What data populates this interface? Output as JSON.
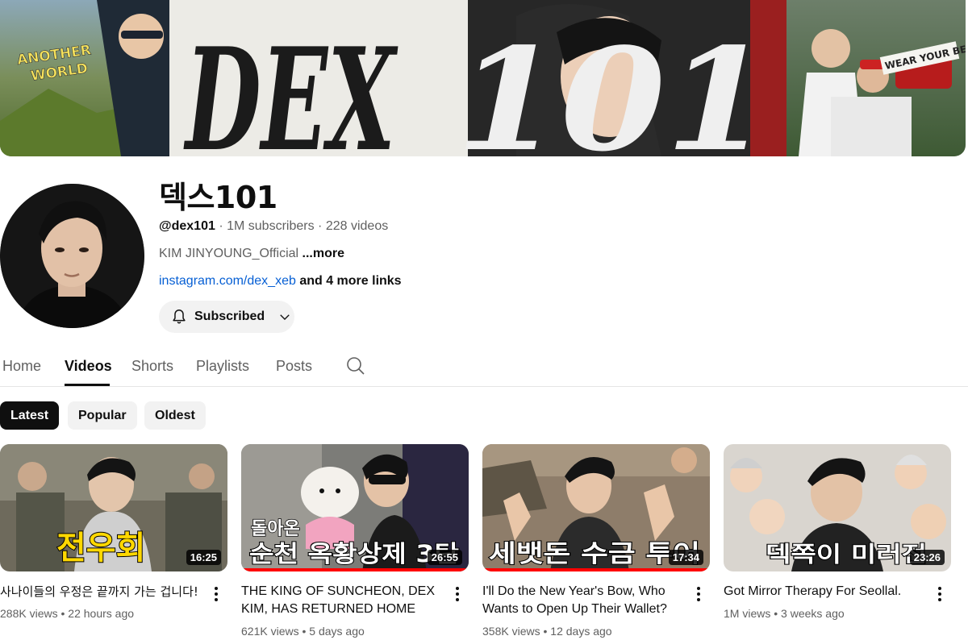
{
  "channel": {
    "name": "덱스101",
    "handle": "@dex101",
    "subscribers": "1M subscribers",
    "videos_count": "228 videos",
    "separator": "·",
    "description": "KIM JINYOUNG_Official",
    "description_more": "...more",
    "link_text": "instagram.com/dex_xeb",
    "more_links": "and 4 more links",
    "subscribe_label": "Subscribed"
  },
  "banner": {
    "title_text": "DEX101",
    "badge_left": "ANOTHER WORLD",
    "badge_right": "WEAR YOUR BEST"
  },
  "tabs": [
    {
      "label": "Home",
      "active": false
    },
    {
      "label": "Videos",
      "active": true
    },
    {
      "label": "Shorts",
      "active": false
    },
    {
      "label": "Playlists",
      "active": false
    },
    {
      "label": "Posts",
      "active": false
    }
  ],
  "chips": [
    {
      "label": "Latest",
      "active": true
    },
    {
      "label": "Popular",
      "active": false
    },
    {
      "label": "Oldest",
      "active": false
    }
  ],
  "videos": [
    {
      "title": "사나이들의 우정은 끝까지 가는 겁니다!",
      "duration": "16:25",
      "views": "288K views",
      "age": "22 hours ago",
      "thumb_caption": "전우회",
      "progress": 0.0
    },
    {
      "title": "THE KING OF SUNCHEON, DEX KIM, HAS RETURNED HOME AFTER TW...",
      "duration": "26:55",
      "views": "621K views",
      "age": "5 days ago",
      "thumb_caption_top": "돌아온",
      "thumb_caption": "순천 옥황상제 3탄",
      "progress": 1.0
    },
    {
      "title": "I'll Do the New Year's Bow, Who Wants to Open Up Their Wallet?",
      "duration": "17:34",
      "views": "358K views",
      "age": "12 days ago",
      "thumb_caption": "세뱃돈 수금 투어",
      "progress": 1.0
    },
    {
      "title": "Got Mirror Therapy For Seollal.",
      "duration": "23:26",
      "views": "1M views",
      "age": "3 weeks ago",
      "thumb_caption": "덱쪽이 미러전",
      "progress": 0.0
    }
  ],
  "meta_dot": "•",
  "icons": {
    "bell": "bell-icon",
    "chevron": "chevron-down-icon",
    "search": "search-icon",
    "more": "more-vert-icon"
  },
  "colors": {
    "link": "#065fd4",
    "chip_active_bg": "#0f0f0f",
    "chip_bg": "#f2f2f2",
    "progress": "#ff0000",
    "caption_yellow": "#ffd800"
  }
}
